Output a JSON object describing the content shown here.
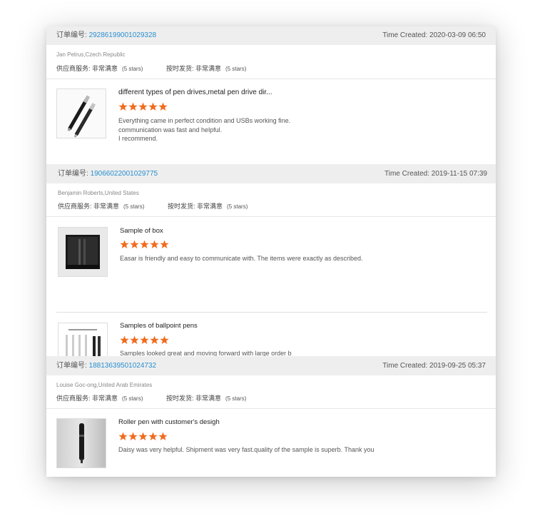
{
  "orders": [
    {
      "label": "订单编号:",
      "number": "29286199001029328",
      "time_created": "Time Created: 2020-03-09 06:50",
      "buyer": "Jan Petrus,Czech Republic",
      "supplier_service": {
        "label": "供应商服务:",
        "value": "非常满意",
        "note": "(5 stars)"
      },
      "on_time": {
        "label": "按时发货:",
        "value": "非常满意",
        "note": "(5 stars)"
      },
      "items": [
        {
          "title": "different types of pen drives,metal pen drive dir...",
          "rating": 5,
          "review_lines": [
            "Everything came in perfect condition and USBs working fine.",
            "communication was fast and helpful.",
            "I recommend."
          ]
        }
      ]
    },
    {
      "label": "订单编号:",
      "number": "19066022001029775",
      "time_created": "Time Created: 2019-11-15 07:39",
      "buyer": "Benjamin Roberts,United States",
      "supplier_service": {
        "label": "供应商服务:",
        "value": "非常满意",
        "note": "(5 stars)"
      },
      "on_time": {
        "label": "按时发货:",
        "value": "非常满意",
        "note": "(5 stars)"
      },
      "items": [
        {
          "title": "Sample of box",
          "rating": 5,
          "review_lines": [
            "Easar is friendly and easy to communicate with. The items were exactly as described."
          ]
        },
        {
          "title": "Samples of ballpoint pens",
          "rating": 5,
          "review_lines": [
            "Samples looked great and moving forward with large order b"
          ]
        }
      ]
    },
    {
      "label": "订单编号:",
      "number": "18813639501024732",
      "time_created": "Time Created: 2019-09-25 05:37",
      "buyer": "Louise Goc-ong,United Arab Emirates",
      "supplier_service": {
        "label": "供应商服务:",
        "value": "非常满意",
        "note": "(5 stars)"
      },
      "on_time": {
        "label": "按时发货:",
        "value": "非常满意",
        "note": "(5 stars)"
      },
      "items": [
        {
          "title": "Roller pen with customer's desigh",
          "rating": 5,
          "review_lines": [
            "Daisy was very helpful. Shipment was very fast.quality of the sample is superb.  Thank you"
          ]
        }
      ]
    }
  ],
  "star_color": "#f26b1d",
  "link_color": "#2a8fd0"
}
